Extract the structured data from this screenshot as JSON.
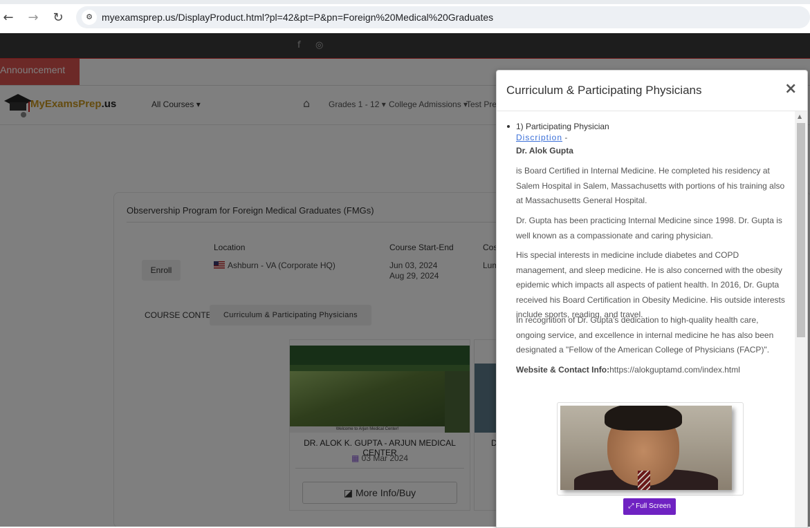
{
  "browser": {
    "back_icon": "←",
    "forward_icon": "→",
    "reload_icon": "↻",
    "site_info_icon": "⚙",
    "url": "myexamsprep.us/DisplayProduct.html?pl=42&pt=P&pn=Foreign%20Medical%20Graduates"
  },
  "topbar": {
    "facebook": "f",
    "instagram": "◎"
  },
  "announcement": "Announcement",
  "header": {
    "logo_part1": "MyExamsPrep",
    "logo_part2": ".us",
    "all_courses": "All Courses ▾",
    "home_icon": "⌂",
    "nav": [
      "Grades 1 - 12 ▾",
      "College Admissions ▾",
      "Test Prep"
    ]
  },
  "program": {
    "title": "Observership Program for Foreign Medical Graduates (FMGs)",
    "enroll_label": "Enroll",
    "location_header": "Location",
    "location_value": "Ashburn - VA (Corporate HQ)",
    "dates_header": "Course Start-End",
    "start_date": "Jun 03, 2024",
    "end_date": "Aug 29, 2024",
    "cost_header": "Cost",
    "cost_value": "Lum",
    "course_content_label": "COURSE CONTENT :",
    "curriculum_button": "Curriculum & Participating Physicians"
  },
  "product": {
    "thumb_footer": "Welcome to Arjun Medical Center!",
    "title": "DR. ALOK K. GUPTA - ARJUN MEDICAL CENTER",
    "date_icon": "▦",
    "date": "03 Mar 2024",
    "button_icon": "◪",
    "button_label": "More Info/Buy",
    "second_title_fragment": "D"
  },
  "modal": {
    "title": "Curriculum & Participating Physicians",
    "close": "×",
    "item_heading": "1) Participating Physician",
    "description_link": "Discription",
    "description_suffix": "-",
    "physician_name": "Dr. Alok Gupta",
    "paragraphs": [
      "is Board Certified in Internal Medicine. He completed his residency at Salem Hospital in Salem, Massachusetts with portions of his training also at Massachusetts General Hospital.",
      "Dr. Gupta has been practicing Internal Medicine since 1998. Dr. Gupta is well known as a compassionate and caring physician.",
      "His special interests in medicine include diabetes and COPD management, and sleep medicine. He is also concerned with the obesity epidemic which impacts all aspects of patient health. In 2016, Dr. Gupta received his Board Certification in Obesity Medicine. His outside interests include sports, reading, and travel.",
      "In recognition of Dr. Gupta's dedication to high-quality health care, ongoing service, and excellence in internal medicine he has also been designated a \"Fellow of the American College of Physicians (FACP)\"."
    ],
    "website_label": "Website & Contact Info:",
    "website_url": "https://alokguptamd.com/index.html",
    "fullscreen_icon": "⤢",
    "fullscreen_label": "Full Screen",
    "scroll_up_icon": "▲"
  }
}
